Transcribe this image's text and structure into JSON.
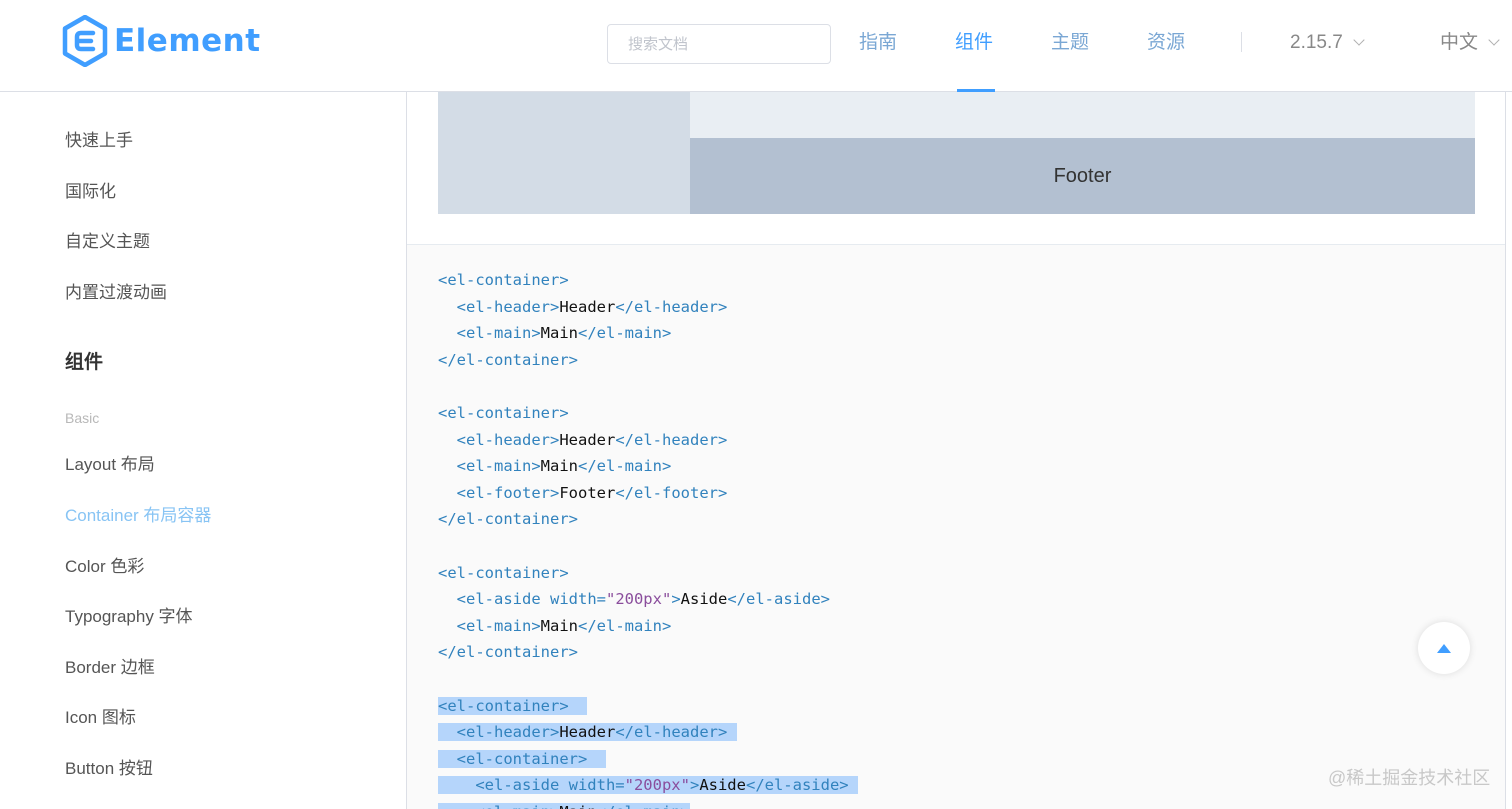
{
  "header": {
    "logo_text": "Element",
    "search_placeholder": "搜索文档",
    "nav": [
      {
        "label": "指南",
        "active": false
      },
      {
        "label": "组件",
        "active": true
      },
      {
        "label": "主题",
        "active": false
      },
      {
        "label": "资源",
        "active": false
      }
    ],
    "version": "2.15.7",
    "language": "中文"
  },
  "sidebar": {
    "items": [
      "快速上手",
      "国际化",
      "自定义主题",
      "内置过渡动画"
    ],
    "section_title": "组件",
    "group_title": "Basic",
    "components": [
      {
        "label": "Layout 布局",
        "active": false
      },
      {
        "label": "Container 布局容器",
        "active": true
      },
      {
        "label": "Color 色彩",
        "active": false
      },
      {
        "label": "Typography 字体",
        "active": false
      },
      {
        "label": "Border 边框",
        "active": false
      },
      {
        "label": "Icon 图标",
        "active": false
      },
      {
        "label": "Button 按钮",
        "active": false
      }
    ]
  },
  "demo": {
    "footer_label": "Footer"
  },
  "code": {
    "block1": [
      "<el-container>",
      "<el-header>",
      "Header",
      "</el-header>",
      "<el-main>",
      "Main",
      "</el-main>",
      "</el-container>"
    ],
    "block2_footer": [
      "<el-footer>",
      "Footer",
      "</el-footer>"
    ],
    "aside_open": "<el-aside width=",
    "aside_width": "\"200px\"",
    "aside_text": "Aside",
    "aside_close": "</el-aside>"
  },
  "watermark": "@稀土掘金技术社区",
  "colors": {
    "primary": "#409EFF",
    "aside": "#d3dce6",
    "main": "#e9eef3",
    "footer": "#b3c0d1",
    "selection": "#b5d5fb"
  }
}
